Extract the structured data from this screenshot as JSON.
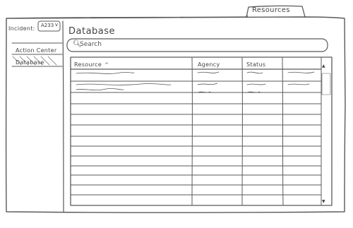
{
  "top_tab": {
    "label": "Resources"
  },
  "incident": {
    "label": "Incident:",
    "value": "A233",
    "caret": "v"
  },
  "sidebar": {
    "items": [
      {
        "label": "Action Center"
      },
      {
        "label": "Database"
      }
    ]
  },
  "main": {
    "title": "Database",
    "search": {
      "placeholder": "Search",
      "icon": "search-icon"
    },
    "table": {
      "columns": [
        {
          "label": "Resource",
          "sort": "^"
        },
        {
          "label": "Agency"
        },
        {
          "label": "Status"
        },
        {
          "label": ""
        }
      ],
      "rows_with_scribbles": 3,
      "empty_rows": 12
    }
  },
  "scrollbar": {
    "up": "▲",
    "down": "▼"
  }
}
